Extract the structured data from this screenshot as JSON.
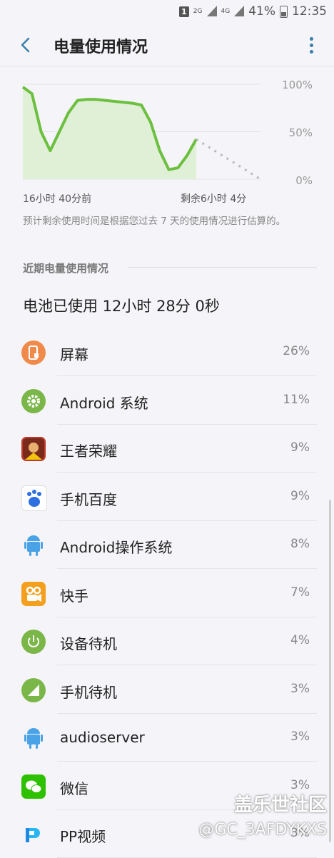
{
  "status": {
    "sim": "1",
    "net_small": "2G",
    "net": "4G",
    "battery": "41%",
    "time": "12:35"
  },
  "appbar": {
    "title": "电量使用情况"
  },
  "chart_data": {
    "type": "area",
    "y_ticks": [
      "100%",
      "50%",
      "0%"
    ],
    "x_labels": [
      "16小时 40分前",
      "剩余6小时 4分"
    ],
    "grid": true,
    "ylim": [
      0,
      100
    ],
    "series": [
      {
        "values": [
          97,
          90,
          50,
          30,
          50,
          70,
          83,
          84,
          84,
          83,
          82,
          81,
          80,
          78,
          60,
          30,
          10,
          12,
          25,
          42
        ]
      },
      {
        "values": [
          42,
          0
        ],
        "style": "dotted-projection"
      }
    ]
  },
  "note": "预计剩余使用时间是根据您过去 7 天的使用情况进行估算的。",
  "section": {
    "title": "近期电量使用情况"
  },
  "battery_used": "电池已使用 12小时 28分 0秒",
  "items": [
    {
      "name": "屏幕",
      "pct": "26%",
      "icon": "screen-icon",
      "color": "#f08a4b"
    },
    {
      "name": "Android 系统",
      "pct": "11%",
      "icon": "android-system-gear-icon",
      "color": "#7ab648"
    },
    {
      "name": "王者荣耀",
      "pct": "9%",
      "icon": "honor-of-kings-icon",
      "color": "#c0392b"
    },
    {
      "name": "手机百度",
      "pct": "9%",
      "icon": "baidu-paw-icon",
      "color": "#2f6fe0"
    },
    {
      "name": "Android操作系统",
      "pct": "8%",
      "icon": "android-robot-icon",
      "color": "#4aa3e6"
    },
    {
      "name": "快手",
      "pct": "7%",
      "icon": "kuaishou-icon",
      "color": "#f59f1e"
    },
    {
      "name": "设备待机",
      "pct": "4%",
      "icon": "power-standby-icon",
      "color": "#7ab648"
    },
    {
      "name": "手机待机",
      "pct": "3%",
      "icon": "signal-standby-icon",
      "color": "#7ab648"
    },
    {
      "name": "audioserver",
      "pct": "3%",
      "icon": "android-robot-icon",
      "color": "#4aa3e6"
    },
    {
      "name": "微信",
      "pct": "3%",
      "icon": "wechat-icon",
      "color": "#2dc100"
    },
    {
      "name": "PP视频",
      "pct": "3%",
      "icon": "pp-video-icon",
      "color": "#1e88e5"
    }
  ],
  "watermark": {
    "line1": "盖乐世社区",
    "line2": "@GC_3AFDYKXS"
  }
}
